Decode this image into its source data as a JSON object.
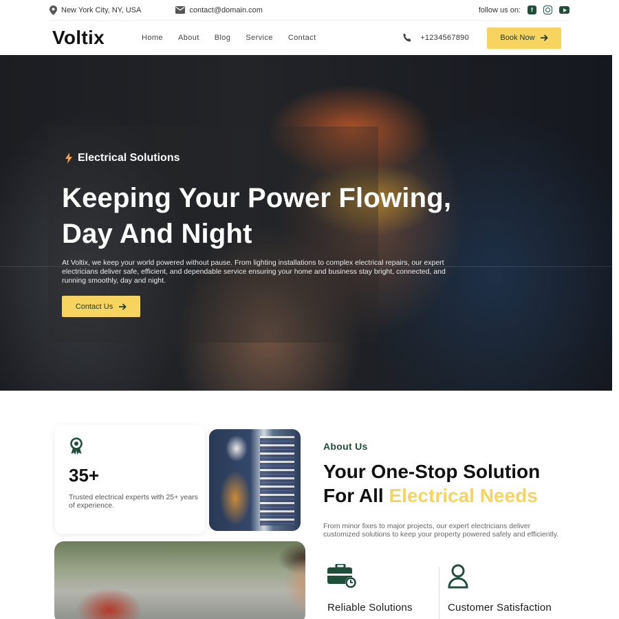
{
  "topbar": {
    "location": "New York City, NY, USA",
    "email": "contact@domain.com",
    "follow_label": "follow us on:",
    "socials": [
      "facebook-icon",
      "instagram-icon",
      "youtube-icon"
    ]
  },
  "nav": {
    "logo": "Voltix",
    "items": [
      "Home",
      "About",
      "Blog",
      "Service",
      "Contact"
    ],
    "phone": "+1234567890",
    "book_label": "Book Now"
  },
  "hero": {
    "tag": "Electrical Solutions",
    "title_line1": "Keeping Your Power Flowing,",
    "title_line2": "Day And Night",
    "text": "At Voltix, we keep your world powered without pause. From lighting installations to complex electrical repairs, our expert electricians deliver safe, efficient, and dependable service ensuring your home and business stay bright, connected, and running smoothly, day and night.",
    "cta_label": "Contact Us"
  },
  "about": {
    "stat_number": "35+",
    "stat_text": "Trusted electrical experts with 25+ years of experience.",
    "label": "About Us",
    "title_line1": "Your One-Stop Solution",
    "title_prefix": "For All ",
    "title_highlight": "Electrical Needs",
    "text": "From minor fixes to major projects, our expert electricians deliver customized solutions to keep your property powered safely and efficiently.",
    "features": [
      "Reliable Solutions",
      "Customer Satisfaction"
    ]
  },
  "colors": {
    "accent": "#f7d460",
    "brand_green": "#1f4f3a"
  }
}
